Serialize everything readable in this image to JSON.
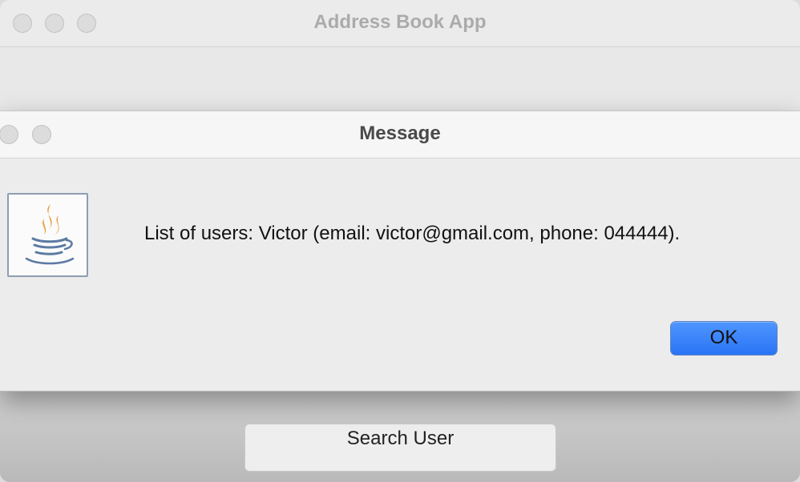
{
  "main_window": {
    "title": "Address Book App",
    "search_button_label": "Search User"
  },
  "dialog": {
    "title": "Message",
    "message": "List of users: Victor (email: victor@gmail.com, phone: 044444).",
    "ok_label": "OK",
    "icon": "java-icon"
  },
  "colors": {
    "ok_button": "#2a74f5",
    "window_bg": "#ececec"
  }
}
